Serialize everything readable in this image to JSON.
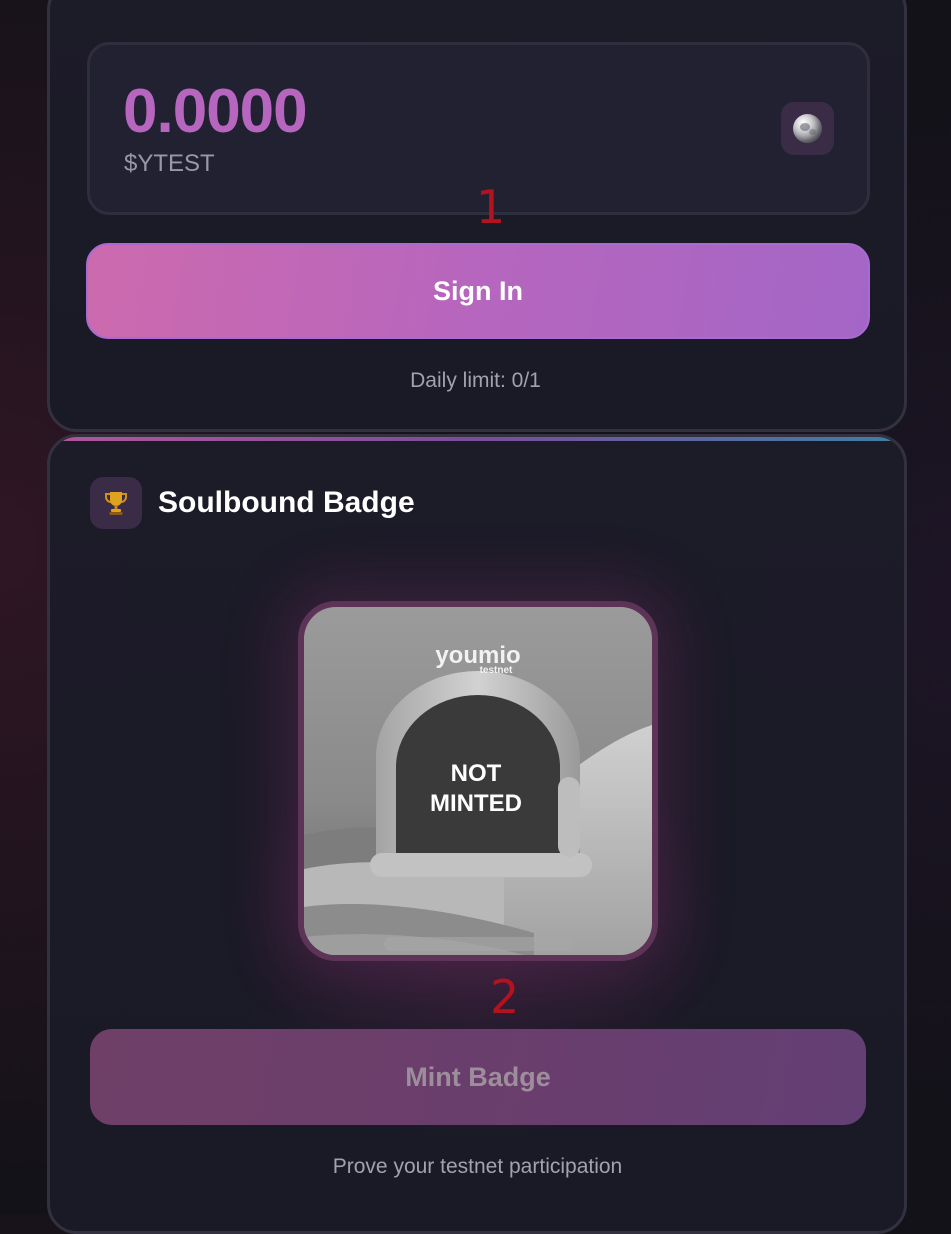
{
  "balance": {
    "value": "0.0000",
    "unit": "$YTEST",
    "icon": "silver-coin-icon"
  },
  "sign_in": {
    "label": "Sign In",
    "daily_limit": "Daily limit: 0/1"
  },
  "badge": {
    "title": "Soulbound Badge",
    "title_icon": "trophy-icon",
    "image": {
      "brand": "youmio",
      "brand_sub": "testnet",
      "status_line1": "NOT",
      "status_line2": "MINTED"
    },
    "mint_label": "Mint Badge",
    "caption": "Prove your testnet participation"
  },
  "annotations": [
    "1",
    "2"
  ],
  "colors": {
    "background": "#141219",
    "card": "#1c1b28",
    "accent_pink": "#cd6aae",
    "accent_purple": "#a466c6",
    "balance_text": "#b766c0",
    "annotation_red": "#b3121f"
  }
}
